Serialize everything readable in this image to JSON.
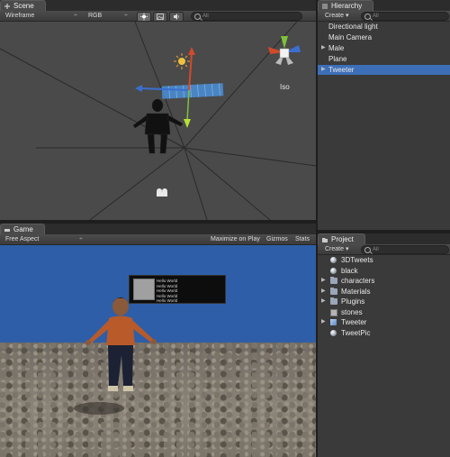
{
  "scene": {
    "tab_label": "Scene",
    "render_mode": "Wireframe",
    "color_mode": "RGB",
    "search_placeholder": "All",
    "view_label": "Iso"
  },
  "game": {
    "tab_label": "Game",
    "aspect": "Free Aspect",
    "maximize_on_play": "Maximize on Play",
    "gizmos": "Gizmos",
    "stats": "Stats",
    "tweet_lines": [
      "Hello World",
      "Hello World",
      "Hello World",
      "Hello World",
      "Hello World"
    ]
  },
  "hierarchy": {
    "tab_label": "Hierarchy",
    "create_label": "Create",
    "search_placeholder": "All",
    "items": [
      {
        "label": "Directional light",
        "expandable": false,
        "selected": false
      },
      {
        "label": "Main Camera",
        "expandable": false,
        "selected": false
      },
      {
        "label": "Male",
        "expandable": true,
        "selected": false
      },
      {
        "label": "Plane",
        "expandable": false,
        "selected": false
      },
      {
        "label": "Tweeter",
        "expandable": true,
        "selected": true
      }
    ]
  },
  "project": {
    "tab_label": "Project",
    "create_label": "Create",
    "search_placeholder": "All",
    "items": [
      {
        "label": "3DTweets",
        "icon": "sphere-icon",
        "expandable": false
      },
      {
        "label": "black",
        "icon": "sphere-icon",
        "expandable": false
      },
      {
        "label": "characters",
        "icon": "folder-icon",
        "expandable": true
      },
      {
        "label": "Materials",
        "icon": "folder-icon",
        "expandable": true
      },
      {
        "label": "Plugins",
        "icon": "folder-icon",
        "expandable": true
      },
      {
        "label": "stones",
        "icon": "texture-icon",
        "expandable": false
      },
      {
        "label": "Tweeter",
        "icon": "prefab-icon",
        "expandable": true
      },
      {
        "label": "TweetPic",
        "icon": "sphere-icon",
        "expandable": false
      }
    ]
  },
  "colors": {
    "selection": "#3d6fb8",
    "sky": "#2e5ea8",
    "panel": "#3a3a3a"
  }
}
